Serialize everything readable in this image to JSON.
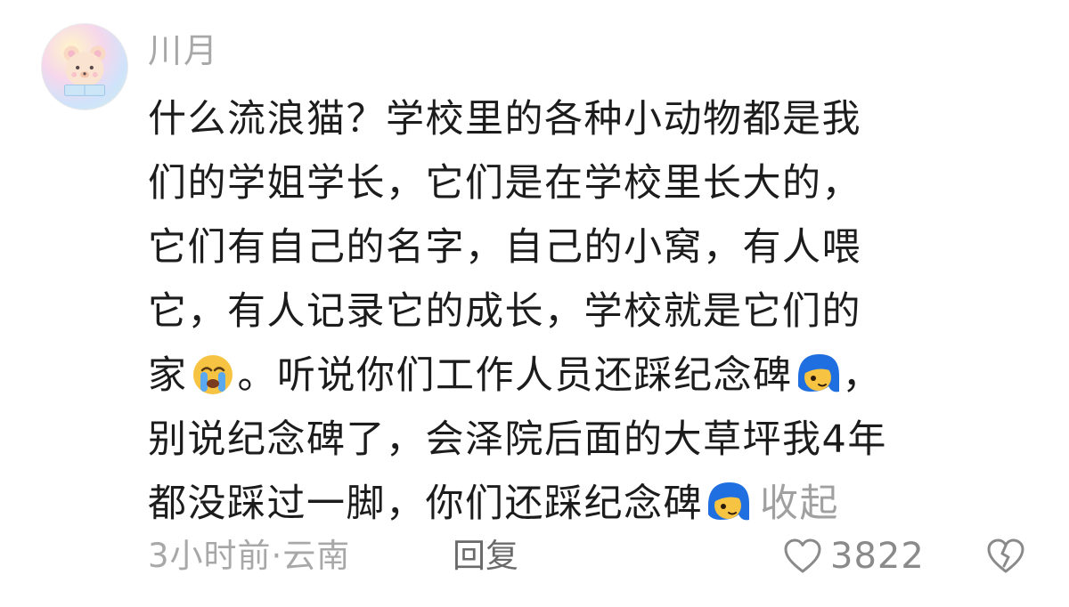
{
  "comment": {
    "username": "川月",
    "avatar_icon": "bear-avatar",
    "lines": {
      "l1": "什么流浪猫？学校里的各种小动物都是我",
      "l2": "们的学姐学长，它们是在学校里长大的，",
      "l3": "它们有自己的名字，自己的小窝，有人喂",
      "l4": "它，有人记录它的成长，学校就是它们的",
      "l5a": "家",
      "l5b": "。听说你们工作人员还踩纪念碑",
      "l5c": "，",
      "l6": "别说纪念碑了，会泽院后面的大草坪我4年",
      "l7": "都没踩过一脚，你们还踩纪念碑"
    },
    "emojis": {
      "crying": "crying-face-emoji",
      "blue_hair": "blue-hair-face-emoji"
    },
    "collapse_label": "收起",
    "time": "3小时前",
    "separator": "·",
    "location": "云南",
    "reply_label": "回复",
    "like_count": "3822",
    "colors": {
      "meta_gray": "#a8a8a8",
      "text": "#1c1c1c",
      "emoji_blue": "#1f6fe0",
      "emoji_yellow": "#f6c343"
    }
  }
}
